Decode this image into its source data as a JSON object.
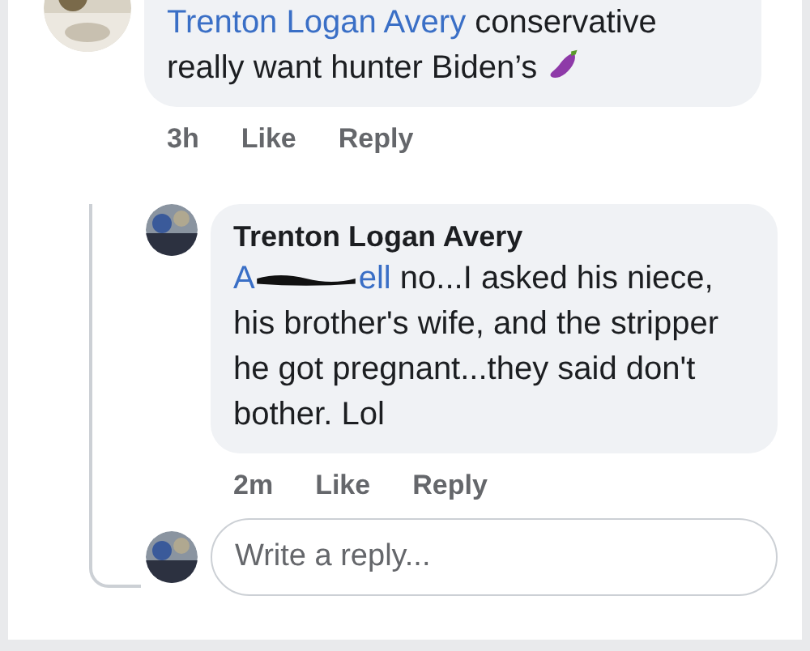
{
  "comments": [
    {
      "mention": "Trenton Logan Avery",
      "text": "conservative really want hunter Biden’s",
      "time": "3h",
      "actions": [
        "Like",
        "Reply"
      ]
    }
  ],
  "reply": {
    "author": "Trenton Logan Avery",
    "mention_start": "A",
    "mention_end": "ell",
    "redacted": true,
    "text": "no...I asked his niece, his brother's wife, and the stripper he got pregnant...they said don't bother. Lol",
    "time": "2m",
    "actions": [
      "Like",
      "Reply"
    ]
  },
  "reply_field": {
    "placeholder": "Write a reply..."
  }
}
